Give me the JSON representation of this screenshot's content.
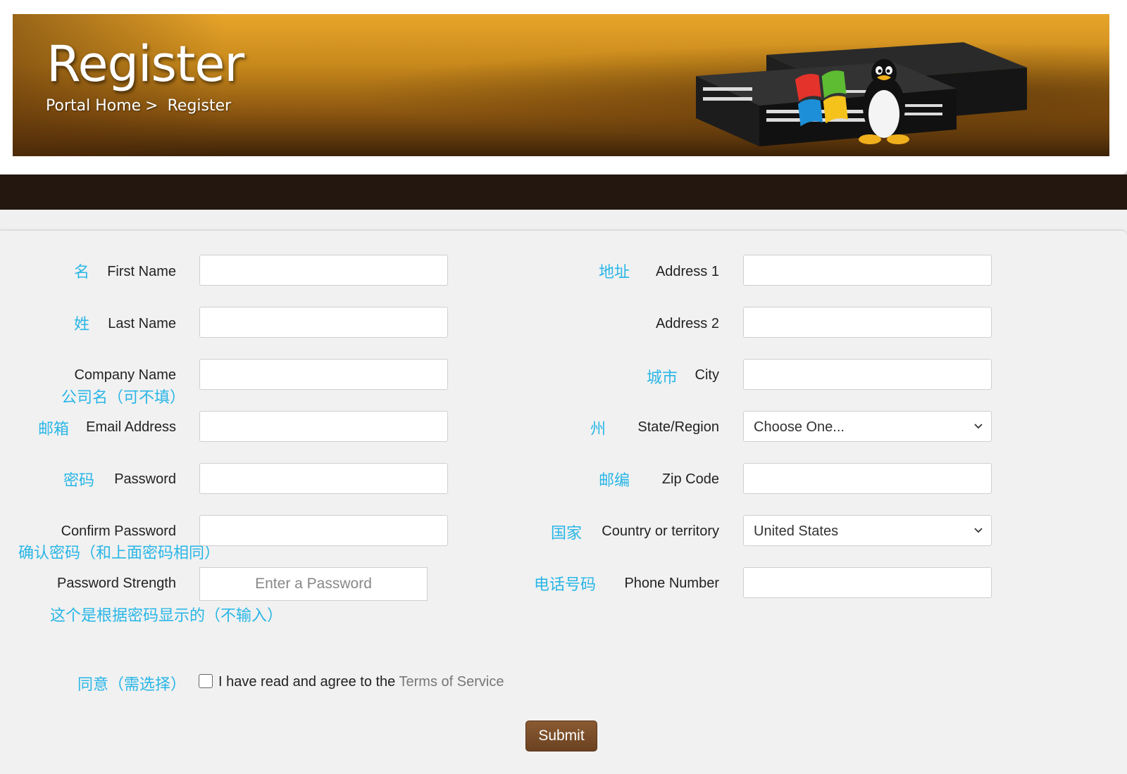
{
  "header": {
    "title": "Register",
    "breadcrumb": {
      "home": "Portal Home",
      "separator": ">",
      "current": "Register"
    }
  },
  "form": {
    "left": {
      "first_name": {
        "cn": "名",
        "label": "First Name",
        "value": ""
      },
      "last_name": {
        "cn": "姓",
        "label": "Last Name",
        "value": ""
      },
      "company_name": {
        "cn": "公司名（可不填）",
        "label": "Company Name",
        "value": ""
      },
      "email": {
        "cn": "邮箱",
        "label": "Email Address",
        "value": ""
      },
      "password": {
        "cn": "密码",
        "label": "Password",
        "value": ""
      },
      "confirm_password": {
        "cn": "确认密码（和上面密码相同）",
        "label": "Confirm Password",
        "value": ""
      },
      "password_strength": {
        "cn": "这个是根据密码显示的（不输入）",
        "label": "Password Strength",
        "text": "Enter a Password"
      }
    },
    "right": {
      "address1": {
        "cn": "地址",
        "label": "Address 1",
        "value": ""
      },
      "address2": {
        "label": "Address 2",
        "value": ""
      },
      "city": {
        "cn": "城市",
        "label": "City",
        "value": ""
      },
      "state": {
        "cn": "州",
        "label": "State/Region",
        "selected": "Choose One..."
      },
      "zip": {
        "cn": "邮编",
        "label": "Zip Code",
        "value": ""
      },
      "country": {
        "cn": "国家",
        "label": "Country or territory",
        "selected": "United States"
      },
      "phone": {
        "cn": "电话号码",
        "label": "Phone Number",
        "value": ""
      }
    },
    "agree": {
      "cn": "同意（需选择）",
      "text": "I have read and agree to the",
      "link": "Terms of Service",
      "checked": false
    },
    "submit_label": "Submit"
  },
  "colors": {
    "accent_cn": "#29b6e6",
    "header_gold": "#e8a52a",
    "dark_strip": "#231710",
    "submit_bg": "#7a4d2a"
  },
  "icons": {
    "banner": "server-switch-with-windows-and-linux-logos",
    "select": "chevron-down-icon"
  }
}
